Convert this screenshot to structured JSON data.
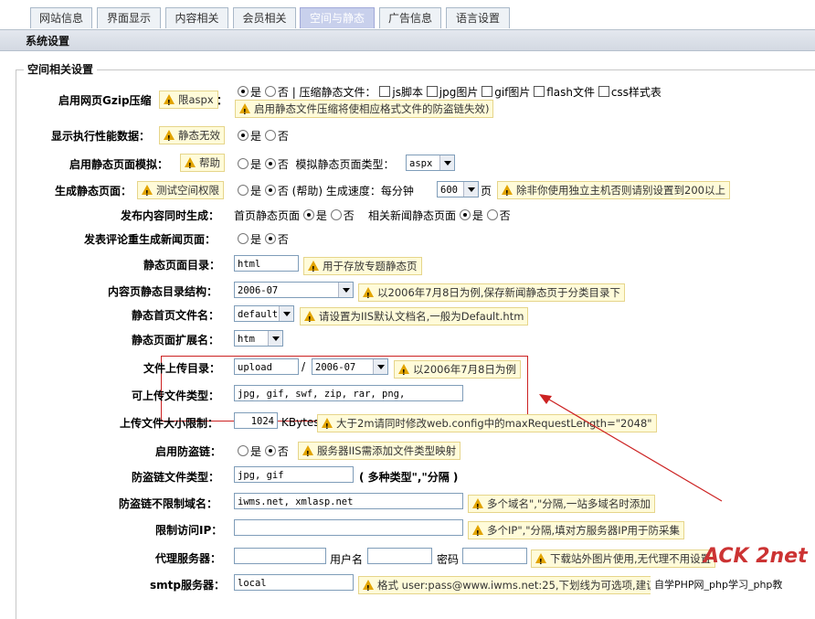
{
  "tabs": [
    "网站信息",
    "界面显示",
    "内容相关",
    "会员相关",
    "空间与静态",
    "广告信息",
    "语言设置"
  ],
  "title": "系统设置",
  "legend": "空间相关设置",
  "rows": {
    "gzip": {
      "label": "启用网页Gzip压缩",
      "tip": "限aspx",
      "colon": "：",
      "yes": "是",
      "no": "否",
      "compress": "| 压缩静态文件：",
      "opts": [
        "js脚本",
        "jpg图片",
        "gif图片",
        "flash文件",
        "css样式表"
      ],
      "tip2": "启用静态文件压缩将使相应格式文件的防盗链失效)"
    },
    "perf": {
      "label": "显示执行性能数据：",
      "tip": "静态无效",
      "yes": "是",
      "no": "否"
    },
    "simulate": {
      "label": "启用静态页面模拟：",
      "tip": "帮助",
      "yes": "是",
      "no": "否",
      "type_label": "模拟静态页面类型：",
      "type_value": "aspx"
    },
    "gen": {
      "label": "生成静态页面：",
      "tip": "测试空间权限",
      "yes": "是",
      "no": "否 (帮助)",
      "speed_label": "生成速度：每分钟",
      "speed_value": "600",
      "unit": "页",
      "tip2": "除非你使用独立主机否则请别设置到200以上"
    },
    "sync": {
      "label": "发布内容同时生成：",
      "home": "首页静态页面",
      "yes": "是",
      "no": "否",
      "news": "相关新闻静态页面"
    },
    "comment": {
      "label": "发表评论重生成新闻页面：",
      "yes": "是",
      "no": "否"
    },
    "dir": {
      "label": "静态页面目录：",
      "value": "html",
      "tip": "用于存放专题静态页"
    },
    "struct": {
      "label": "内容页静态目录结构：",
      "value": "2006-07",
      "tip": "以2006年7月8日为例,保存新闻静态页于分类目录下"
    },
    "index": {
      "label": "静态首页文件名：",
      "value": "default",
      "tip": "请设置为IIS默认文档名,一般为Default.htm"
    },
    "ext": {
      "label": "静态页面扩展名：",
      "value": "htm"
    },
    "upload": {
      "label": "文件上传目录：",
      "value": "upload",
      "sep": "/",
      "sub": "2006-07",
      "tip": "以2006年7月8日为例"
    },
    "types": {
      "label": "可上传文件类型：",
      "value": "jpg, gif, swf, zip, rar, png,"
    },
    "size": {
      "label": "上传文件大小限制：",
      "value": "1024",
      "unit": "KBytes",
      "tip": "大于2m请同时修改web.config中的maxRequestLength=\"2048\""
    },
    "hotlink": {
      "label": "启用防盗链：",
      "yes": "是",
      "no": "否",
      "tip": "服务器IIS需添加文件类型映射"
    },
    "hl_types": {
      "label": "防盗链文件类型：",
      "value": "jpg, gif",
      "note": "( 多种类型\",\"分隔 )"
    },
    "hl_domains": {
      "label": "防盗链不限制域名：",
      "value": "iwms.net, xmlasp.net",
      "tip": "多个域名\",\"分隔,一站多域名时添加"
    },
    "ip": {
      "label": "限制访问IP：",
      "value": "",
      "tip": "多个IP\",\"分隔,填对方服务器IP用于防采集"
    },
    "proxy": {
      "label": "代理服务器：",
      "user": "用户名",
      "pass": "密码",
      "tip": "下载站外图片使用,无代理不用设置"
    },
    "smtp": {
      "label": "smtp服务器：",
      "value": "local",
      "tip": "格式 user:pass@www.iwms.net:25,下划线为可选项,建议"
    }
  },
  "watermark": {
    "logo": "ACK 2net",
    "caption": "自学PHP网_php学习_php教"
  }
}
